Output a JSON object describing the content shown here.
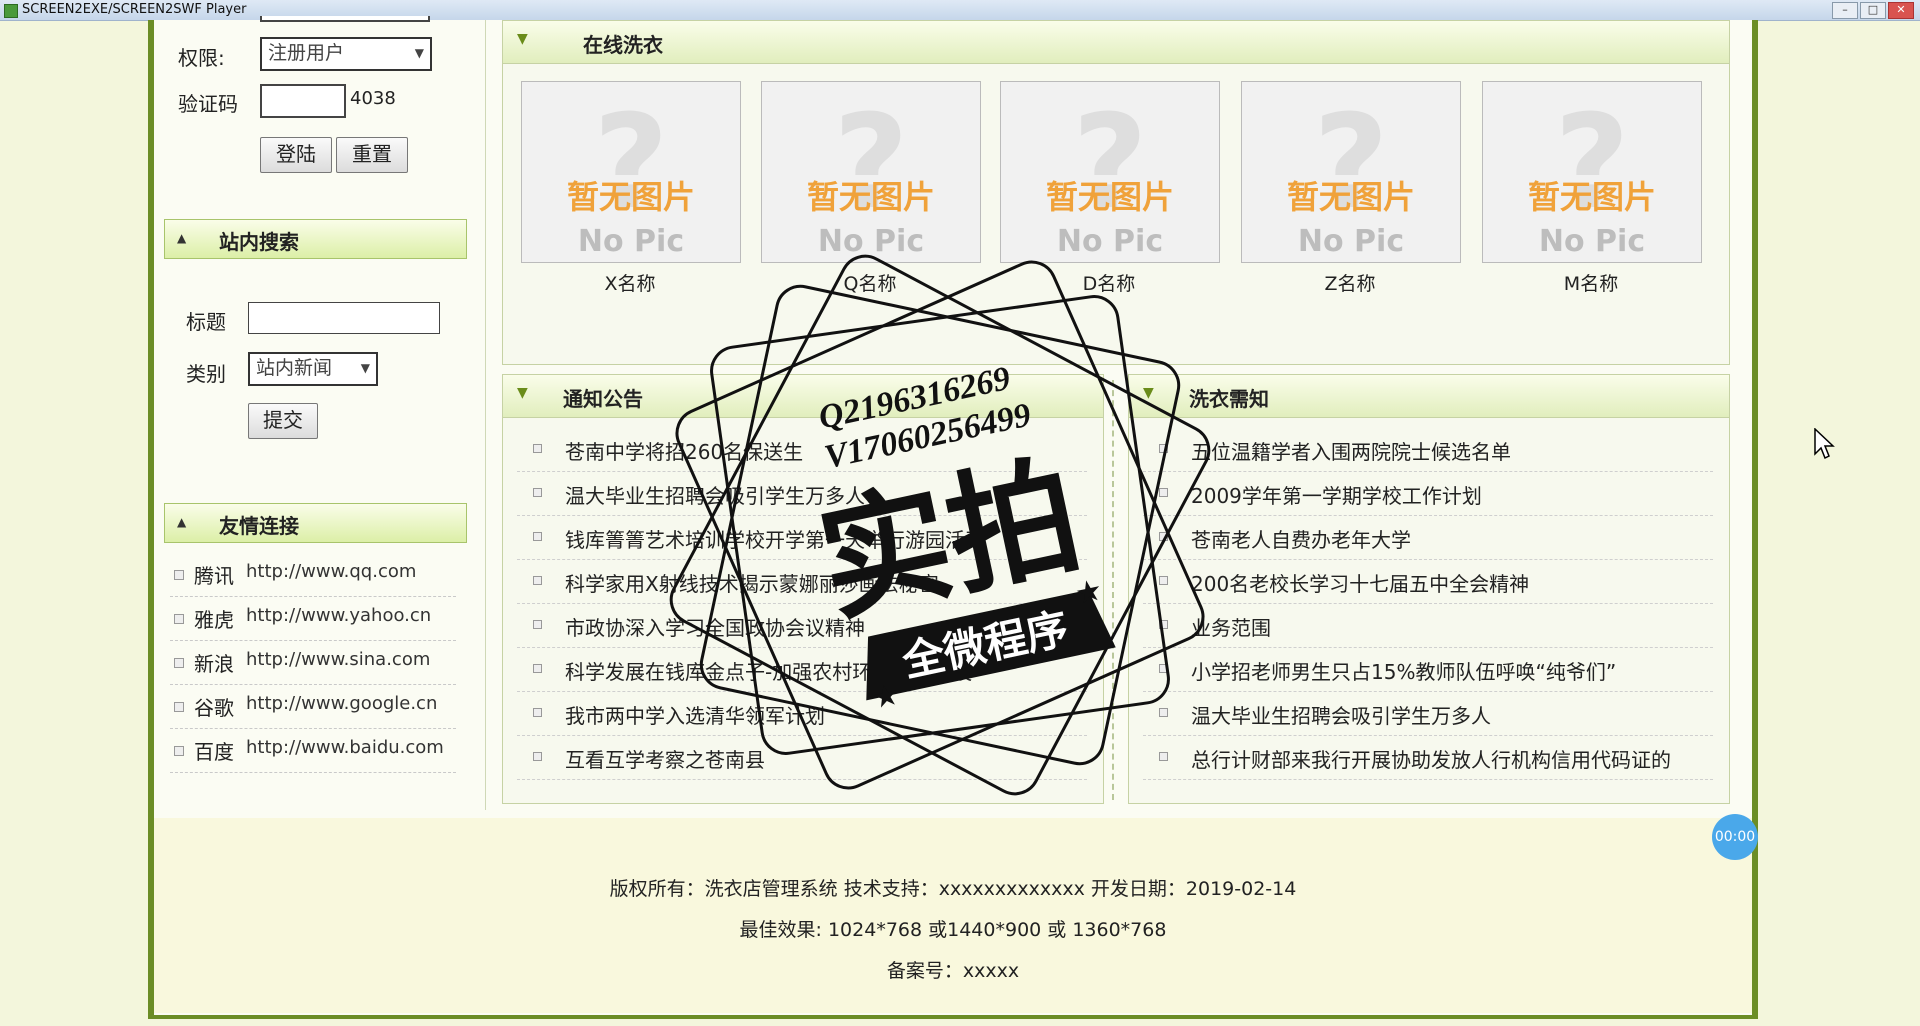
{
  "window": {
    "title": "SCREEN2EXE/SCREEN2SWF Player"
  },
  "login": {
    "perm_label": "权限:",
    "perm_value": "注册用户",
    "captcha_label": "验证码",
    "captcha_code": "4038",
    "login_btn": "登陆",
    "reset_btn": "重置"
  },
  "search": {
    "header": "站内搜索",
    "title_label": "标题",
    "category_label": "类别",
    "category_value": "站内新闻",
    "submit_btn": "提交"
  },
  "links": {
    "header": "友情连接",
    "items": [
      {
        "name": "腾讯",
        "url": "http://www.qq.com"
      },
      {
        "name": "雅虎",
        "url": "http://www.yahoo.cn"
      },
      {
        "name": "新浪",
        "url": "http://www.sina.com"
      },
      {
        "name": "谷歌",
        "url": "http://www.google.cn"
      },
      {
        "name": "百度",
        "url": "http://www.baidu.com"
      }
    ]
  },
  "online": {
    "header": "在线洗衣",
    "pic_zh": "暂无图片",
    "pic_en": "No Pic",
    "items": [
      "X名称",
      "Q名称",
      "D名称",
      "Z名称",
      "M名称"
    ]
  },
  "notice": {
    "header": "通知公告",
    "items": [
      "苍南中学将招260名保送生",
      "温大毕业生招聘会吸引学生万多人",
      "钱库箐箐艺术培训学校开学第一天举行游园活动",
      "科学家用X射线技术揭示蒙娜丽莎画法秘密",
      "市政协深入学习全国政协会议精神",
      "科学发展在钱库金点子-加强农村环境卫生建设",
      "我市两中学入选清华领军计划",
      "互看互学考察之苍南县"
    ]
  },
  "laundry": {
    "header": "洗衣需知",
    "items": [
      "五位温籍学者入围两院院士候选名单",
      "2009学年第一学期学校工作计划",
      "苍南老人自费办老年大学",
      "200名老校长学习十七届五中全会精神",
      "业务范围",
      "小学招老师男生只占15%教师队伍呼唤“纯爷们”",
      "温大毕业生招聘会吸引学生万多人",
      "总行计财部来我行开展协助发放人行机构信用代码证的"
    ]
  },
  "footer": {
    "line1": "版权所有：洗衣店管理系统 技术支持：xxxxxxxxxxxxx 开发日期：2019-02-14",
    "line2": "最佳效果: 1024*768 或1440*900 或 1360*768",
    "line3": "备案号：xxxxx"
  },
  "timer": "00:00",
  "watermark": {
    "qq": "Q2196316269",
    "wx": "V17060256499",
    "main": "实拍",
    "sub": "全微程序"
  }
}
